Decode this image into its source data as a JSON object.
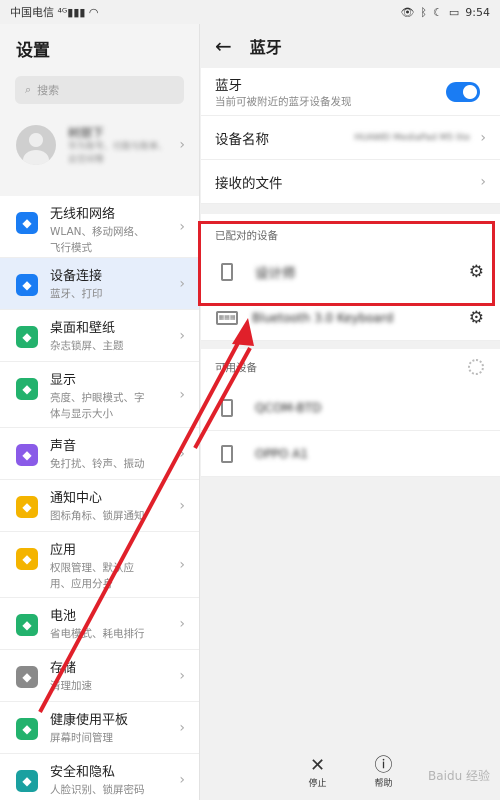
{
  "statusbar": {
    "carrier": "中国电信",
    "time": "9:54"
  },
  "left": {
    "title": "设置",
    "search_placeholder": "搜索",
    "profile": {
      "name": "树朋下",
      "desc1": "华为账号、付款与账单、",
      "desc2": "云空间等"
    },
    "items": [
      {
        "title": "无线和网络",
        "sub1": "WLAN、移动网络、",
        "sub2": "飞行模式",
        "icon": "wifi-icon",
        "color": "#1a7cf3"
      },
      {
        "title": "设备连接",
        "sub1": "蓝牙、打印",
        "sub2": "",
        "icon": "device-link-icon",
        "color": "#1a7cf3"
      },
      {
        "title": "桌面和壁纸",
        "sub1": "杂志锁屏、主题",
        "sub2": "",
        "icon": "wallpaper-icon",
        "color": "#23b26d"
      },
      {
        "title": "显示",
        "sub1": "亮度、护眼模式、字",
        "sub2": "体与显示大小",
        "icon": "display-icon",
        "color": "#23b26d"
      },
      {
        "title": "声音",
        "sub1": "免打扰、铃声、振动",
        "sub2": "",
        "icon": "sound-icon",
        "color": "#8a5be8"
      },
      {
        "title": "通知中心",
        "sub1": "图标角标、锁屏通知",
        "sub2": "",
        "icon": "bell-icon",
        "color": "#f4b400"
      },
      {
        "title": "应用",
        "sub1": "权限管理、默认应",
        "sub2": "用、应用分身",
        "icon": "apps-icon",
        "color": "#f4b400"
      },
      {
        "title": "电池",
        "sub1": "省电模式、耗电排行",
        "sub2": "",
        "icon": "battery-icon",
        "color": "#23b26d"
      },
      {
        "title": "存储",
        "sub1": "清理加速",
        "sub2": "",
        "icon": "storage-icon",
        "color": "#8a8a8a"
      },
      {
        "title": "健康使用平板",
        "sub1": "屏幕时间管理",
        "sub2": "",
        "icon": "hourglass-icon",
        "color": "#23b26d"
      },
      {
        "title": "安全和隐私",
        "sub1": "人脸识别、锁屏密码",
        "sub2": "",
        "icon": "shield-icon",
        "color": "#1aa0a0"
      }
    ]
  },
  "right": {
    "title": "蓝牙",
    "bt_label": "蓝牙",
    "bt_sub": "当前可被附近的蓝牙设备发现",
    "device_name_label": "设备名称",
    "device_name_value": "HUAWEI MediaPad M5 lite",
    "received_files": "接收的文件",
    "paired_label": "已配对的设备",
    "paired": [
      "设计师",
      "Bluetooth 3.0 Keyboard"
    ],
    "available_label": "可用设备",
    "available": [
      "QCOM-BTD",
      "OPPO A1"
    ],
    "stop_label": "停止",
    "help_label": "帮助"
  },
  "watermark": "Baidu 经验",
  "colors": {
    "accent": "#1a7cf3",
    "highlight": "#e0202a"
  }
}
